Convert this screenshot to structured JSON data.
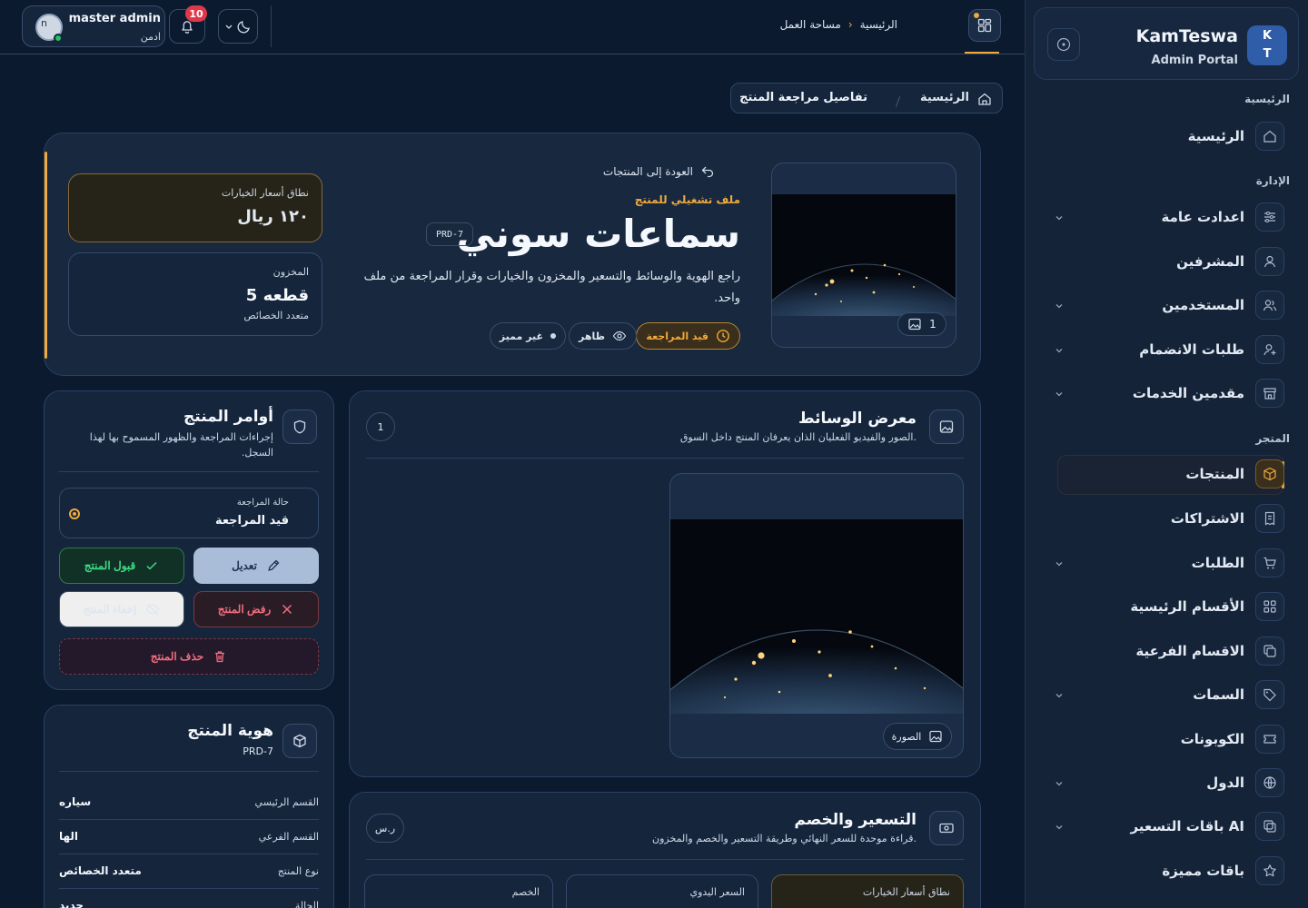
{
  "brand": {
    "logo_line1": "K",
    "logo_line2": "T",
    "title": "KamTeswa",
    "subtitle": "Admin Portal"
  },
  "sidebar": {
    "sections": {
      "home": "الرئيسية",
      "admin": "الإدارة",
      "store": "المتجر"
    },
    "items": [
      {
        "label": "الرئيسية",
        "icon": "home-icon",
        "chevron": false,
        "active": false
      },
      {
        "label": "اعدادت عامة",
        "icon": "sliders-icon",
        "chevron": true,
        "active": false
      },
      {
        "label": "المشرفين",
        "icon": "user-icon",
        "chevron": false,
        "active": false
      },
      {
        "label": "المستخدمين",
        "icon": "users-icon",
        "chevron": true,
        "active": false
      },
      {
        "label": "طلبات الانضمام",
        "icon": "user-plus-icon",
        "chevron": true,
        "active": false
      },
      {
        "label": "مقدمين الخدمات",
        "icon": "store-icon",
        "chevron": true,
        "active": false
      },
      {
        "label": "المنتجات",
        "icon": "box-icon",
        "chevron": false,
        "active": true
      },
      {
        "label": "الاشتراكات",
        "icon": "receipt-icon",
        "chevron": false,
        "active": false
      },
      {
        "label": "الطلبات",
        "icon": "cart-icon",
        "chevron": true,
        "active": false
      },
      {
        "label": "الأقسام الرئيسية",
        "icon": "grid-icon",
        "chevron": false,
        "active": false
      },
      {
        "label": "الاقسام الفرعية",
        "icon": "copy-icon",
        "chevron": false,
        "active": false
      },
      {
        "label": "السمات",
        "icon": "tag-icon",
        "chevron": true,
        "active": false
      },
      {
        "label": "الكوبونات",
        "icon": "ticket-icon",
        "chevron": false,
        "active": false
      },
      {
        "label": "الدول",
        "icon": "globe-icon",
        "chevron": true,
        "active": false
      },
      {
        "label": "باقات التسعير AI",
        "icon": "layers-icon",
        "chevron": true,
        "active": false
      },
      {
        "label": "باقات مميزة",
        "icon": "star-icon",
        "chevron": false,
        "active": false
      }
    ]
  },
  "topbar": {
    "user_name": "master admin",
    "user_role": "ادمن",
    "avatar_initial": "n",
    "notifications": "10",
    "breadcrumb": [
      "الرئيسية",
      "مساحة العمل"
    ]
  },
  "page_breadcrumb": {
    "home": "الرئيسية",
    "current": "تفاصيل مراجعة المنتج"
  },
  "hero": {
    "back": "العودة إلى المنتجات",
    "eyebrow": "ملف تشغيلي للمنتج",
    "title": "سماعات سوني",
    "sku": "PRD-7",
    "description": "راجع الهوية والوسائط والتسعير والمخزون والخيارات وقرار المراجعة من ملف واحد.",
    "image_count": "1",
    "pills": {
      "review": "قيد المراجعة",
      "visible": "ظاهر",
      "featured": "غير مميز"
    },
    "stats": {
      "price_label": "نطاق أسعار الخيارات",
      "price_value": "١٢٠ ريال",
      "stock_label": "المخزون",
      "stock_value": "5 قطعه",
      "stock_sub": "متعدد الخصائص"
    }
  },
  "media": {
    "title": "معرض الوسائط",
    "subtitle": "الصور والفيديو الفعليان الذان يعرفان المنتج داخل السوق.",
    "count": "1",
    "tag": "الصورة"
  },
  "pricing": {
    "title": "التسعير والخصم",
    "subtitle": "قراءة موحدة للسعر النهائي وطريقة التسعير والخصم والمخزون.",
    "currency": "ر.س",
    "boxes": [
      "نطاق أسعار الخيارات",
      "السعر اليدوي",
      "الخصم"
    ]
  },
  "actions": {
    "title": "أوامر المنتج",
    "subtitle": "إجراءات المراجعة والظهور المسموح بها لهذا السجل.",
    "status_label": "حالة المراجعة",
    "status_value": "قيد المراجعة",
    "edit": "تعديل",
    "accept": "قبول المنتج",
    "reject": "رفض المنتج",
    "hide": "إخفاء المنتج",
    "delete": "حذف المنتج"
  },
  "identity": {
    "title": "هوية المنتج",
    "code": "PRD-7",
    "rows": [
      {
        "k": "القسم الرئيسي",
        "v": "سياره"
      },
      {
        "k": "القسم الفرعي",
        "v": "الها"
      },
      {
        "k": "نوع المنتج",
        "v": "متعدد الخصائص"
      },
      {
        "k": "الحالة",
        "v": "جديد"
      }
    ]
  },
  "colors": {
    "accent": "#f0a93a",
    "background": "#0c1a2f",
    "panel": "#14253c",
    "success": "#3ddc84",
    "danger": "#f26d7d"
  }
}
